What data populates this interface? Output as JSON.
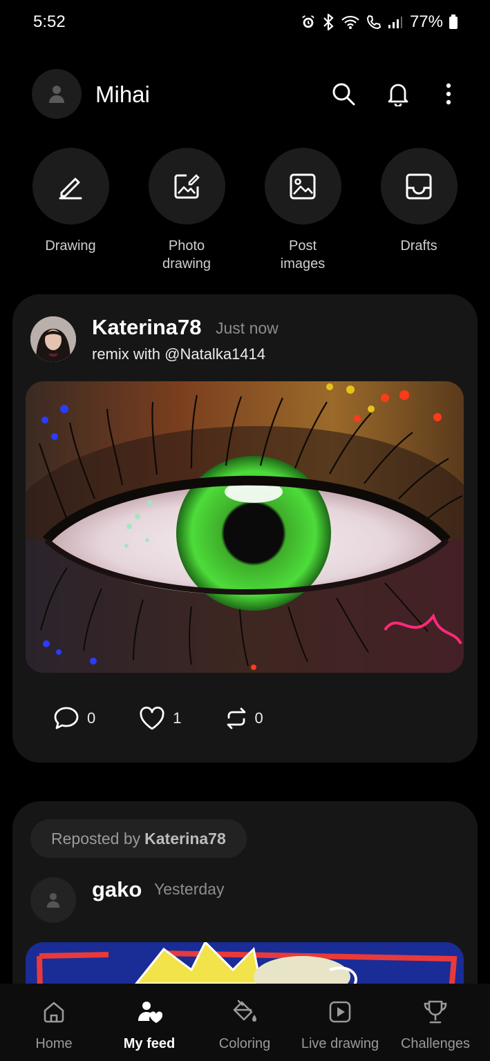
{
  "status_bar": {
    "time": "5:52",
    "battery": "77%"
  },
  "header": {
    "user_name": "Mihai"
  },
  "quick_actions": [
    {
      "label": "Drawing",
      "icon": "pencil-icon"
    },
    {
      "label": "Photo\ndrawing",
      "icon": "photo-edit-icon"
    },
    {
      "label": "Post\nimages",
      "icon": "image-icon"
    },
    {
      "label": "Drafts",
      "icon": "drafts-tray-icon"
    }
  ],
  "posts": [
    {
      "user": "Katerina78",
      "time": "Just now",
      "subtitle": "remix  with @Natalka1414",
      "comments": "0",
      "likes": "1",
      "reposts": "0"
    },
    {
      "repost_prefix": "Reposted by",
      "repost_user": "Katerina78",
      "user": "gako",
      "time": "Yesterday"
    }
  ],
  "bottom_nav": [
    {
      "label": "Home",
      "icon": "home-icon",
      "active": false
    },
    {
      "label": "My feed",
      "icon": "people-heart-icon",
      "active": true
    },
    {
      "label": "Coloring",
      "icon": "paint-bucket-icon",
      "active": false
    },
    {
      "label": "Live drawing",
      "icon": "play-icon",
      "active": false
    },
    {
      "label": "Challenges",
      "icon": "trophy-icon",
      "active": false
    }
  ],
  "colors": {
    "background": "#000000",
    "card": "#161616",
    "muted_text": "#8e8e8e",
    "accent_white": "#ffffff"
  }
}
